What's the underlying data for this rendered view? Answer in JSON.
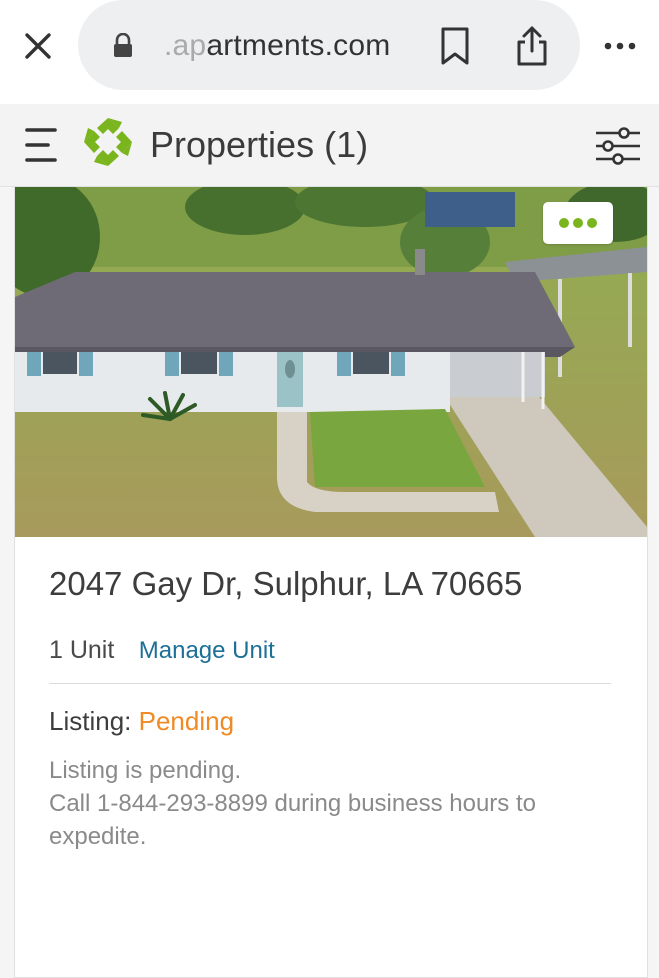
{
  "browser": {
    "url_prefix": ".ap",
    "url_main": "artments.com"
  },
  "header": {
    "title": "Properties (1)"
  },
  "property": {
    "address": "2047 Gay Dr, Sulphur, LA 70665",
    "unit_count": "1 Unit",
    "manage_link": "Manage Unit",
    "listing_label": "Listing:",
    "listing_status": "Pending",
    "message_line1": "Listing is pending.",
    "message_line2": "Call 1-844-293-8899 during business hours to",
    "message_line3": "expedite."
  },
  "colors": {
    "brand_green": "#7ab51d",
    "link_blue": "#1e6f98",
    "status_orange": "#f08a24"
  }
}
